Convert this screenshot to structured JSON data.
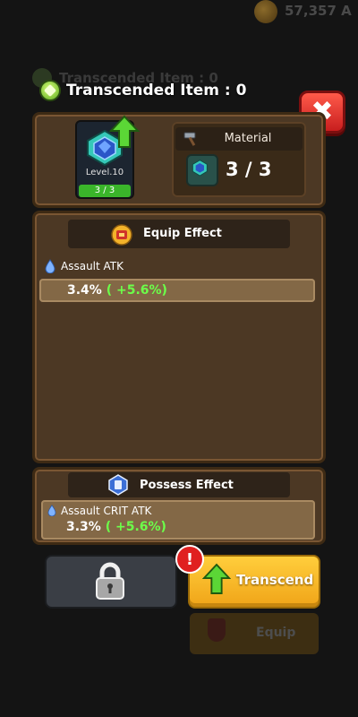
{
  "background": {
    "gold_amount": "57,357 A",
    "dim_title": "Transcended Item : 0",
    "dim_equip_label": "Equip"
  },
  "header": {
    "title": "Transcended Item : 0",
    "close_icon": "close-x-icon"
  },
  "item": {
    "level": "Level.10",
    "count": "3 / 3",
    "icon": "blue-gem-icon"
  },
  "material": {
    "label": "Material",
    "count": "3 / 3",
    "icon": "gem-material-icon"
  },
  "equip_effect": {
    "title": "Equip Effect",
    "stat_label": "Assault ATK",
    "stat_value": "3.4%",
    "stat_bonus": " ( +5.6%)"
  },
  "possess_effect": {
    "title": "Possess Effect",
    "stat_label": "Assault CRIT ATK",
    "stat_value": "3.3%",
    "stat_bonus": " ( +5.6%)"
  },
  "buttons": {
    "lock_icon": "padlock-icon",
    "transcend_label": "Transcend",
    "alert_glyph": "!"
  },
  "colors": {
    "bonus_green": "#6cff4a",
    "transcend_yellow": "#ffce3c",
    "close_red": "#e0261e",
    "panel_brown": "#4c3824"
  }
}
